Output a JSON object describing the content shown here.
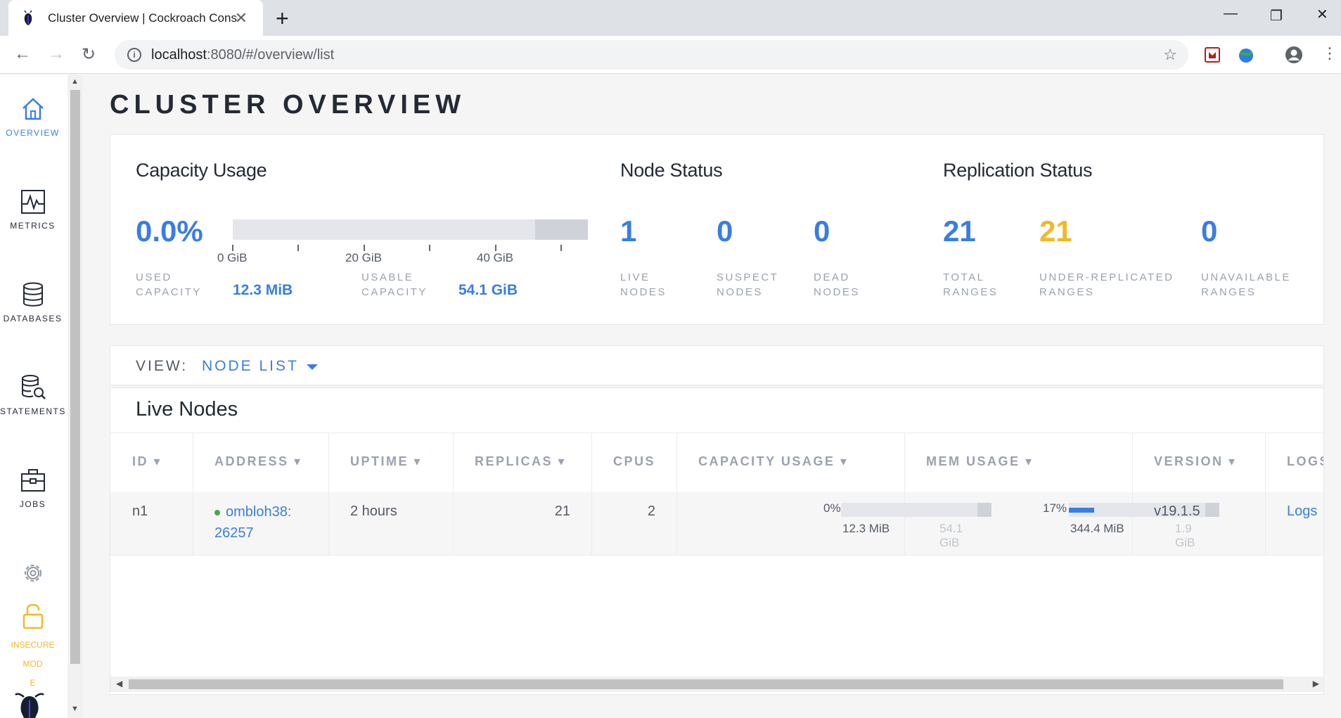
{
  "browser": {
    "tab_title": "Cluster Overview | Cockroach Console",
    "tab_close": "✕",
    "new_tab": "+",
    "url_host": "localhost",
    "url_path": ":8080/#/overview/list"
  },
  "sidebar": {
    "items": [
      {
        "label": "OVERVIEW",
        "icon": "home-icon",
        "active": true
      },
      {
        "label": "METRICS",
        "icon": "metrics-icon",
        "active": false
      },
      {
        "label": "DATABASES",
        "icon": "database-icon",
        "active": false
      },
      {
        "label": "STATEMENTS",
        "icon": "statements-icon",
        "active": false
      },
      {
        "label": "JOBS",
        "icon": "jobs-icon",
        "active": false
      }
    ],
    "insecure_line1": "INSECURE MOD",
    "insecure_line2": "E"
  },
  "page_title": "CLUSTER OVERVIEW",
  "capacity": {
    "title": "Capacity Usage",
    "percent": "0.0%",
    "axis_labels": [
      "0 GiB",
      "20 GiB",
      "40 GiB"
    ],
    "used_label_1": "USED",
    "used_label_2": "CAPACITY",
    "used_value": "12.3 MiB",
    "usable_label_1": "USABLE",
    "usable_label_2": "CAPACITY",
    "usable_value": "54.1 GiB"
  },
  "node_status": {
    "title": "Node Status",
    "live": "1",
    "live_l1": "LIVE",
    "live_l2": "NODES",
    "suspect": "0",
    "suspect_l1": "SUSPECT",
    "suspect_l2": "NODES",
    "dead": "0",
    "dead_l1": "DEAD",
    "dead_l2": "NODES"
  },
  "replication": {
    "title": "Replication Status",
    "total": "21",
    "total_l1": "TOTAL",
    "total_l2": "RANGES",
    "under": "21",
    "under_l1": "UNDER-REPLICATED",
    "under_l2": "RANGES",
    "unavail": "0",
    "unavail_l1": "UNAVAILABLE",
    "unavail_l2": "RANGES"
  },
  "view": {
    "label": "VIEW:",
    "value": "NODE LIST"
  },
  "nodes": {
    "title": "Live Nodes",
    "columns": [
      "ID ▾",
      "ADDRESS ▾",
      "UPTIME ▾",
      "REPLICAS ▾",
      "CPUS",
      "CAPACITY USAGE ▾",
      "MEM USAGE ▾",
      "VERSION ▾",
      "LOGS"
    ],
    "row": {
      "id": "n1",
      "address_1": "ombloh38:",
      "address_2": "26257",
      "uptime": "2 hours",
      "replicas": "21",
      "cpus": "2",
      "cap_pct": "0%",
      "cap_used": "12.3 MiB",
      "cap_total": "54.1 GiB",
      "mem_pct": "17%",
      "mem_fraction": 0.17,
      "mem_used": "344.4 MiB",
      "mem_total": "1.9 GiB",
      "version": "v19.1.5",
      "logs": "Logs"
    }
  },
  "colors": {
    "accent_blue": "#3a7de1",
    "warning_yellow": "#f4b827",
    "live_green": "#3fad46"
  }
}
